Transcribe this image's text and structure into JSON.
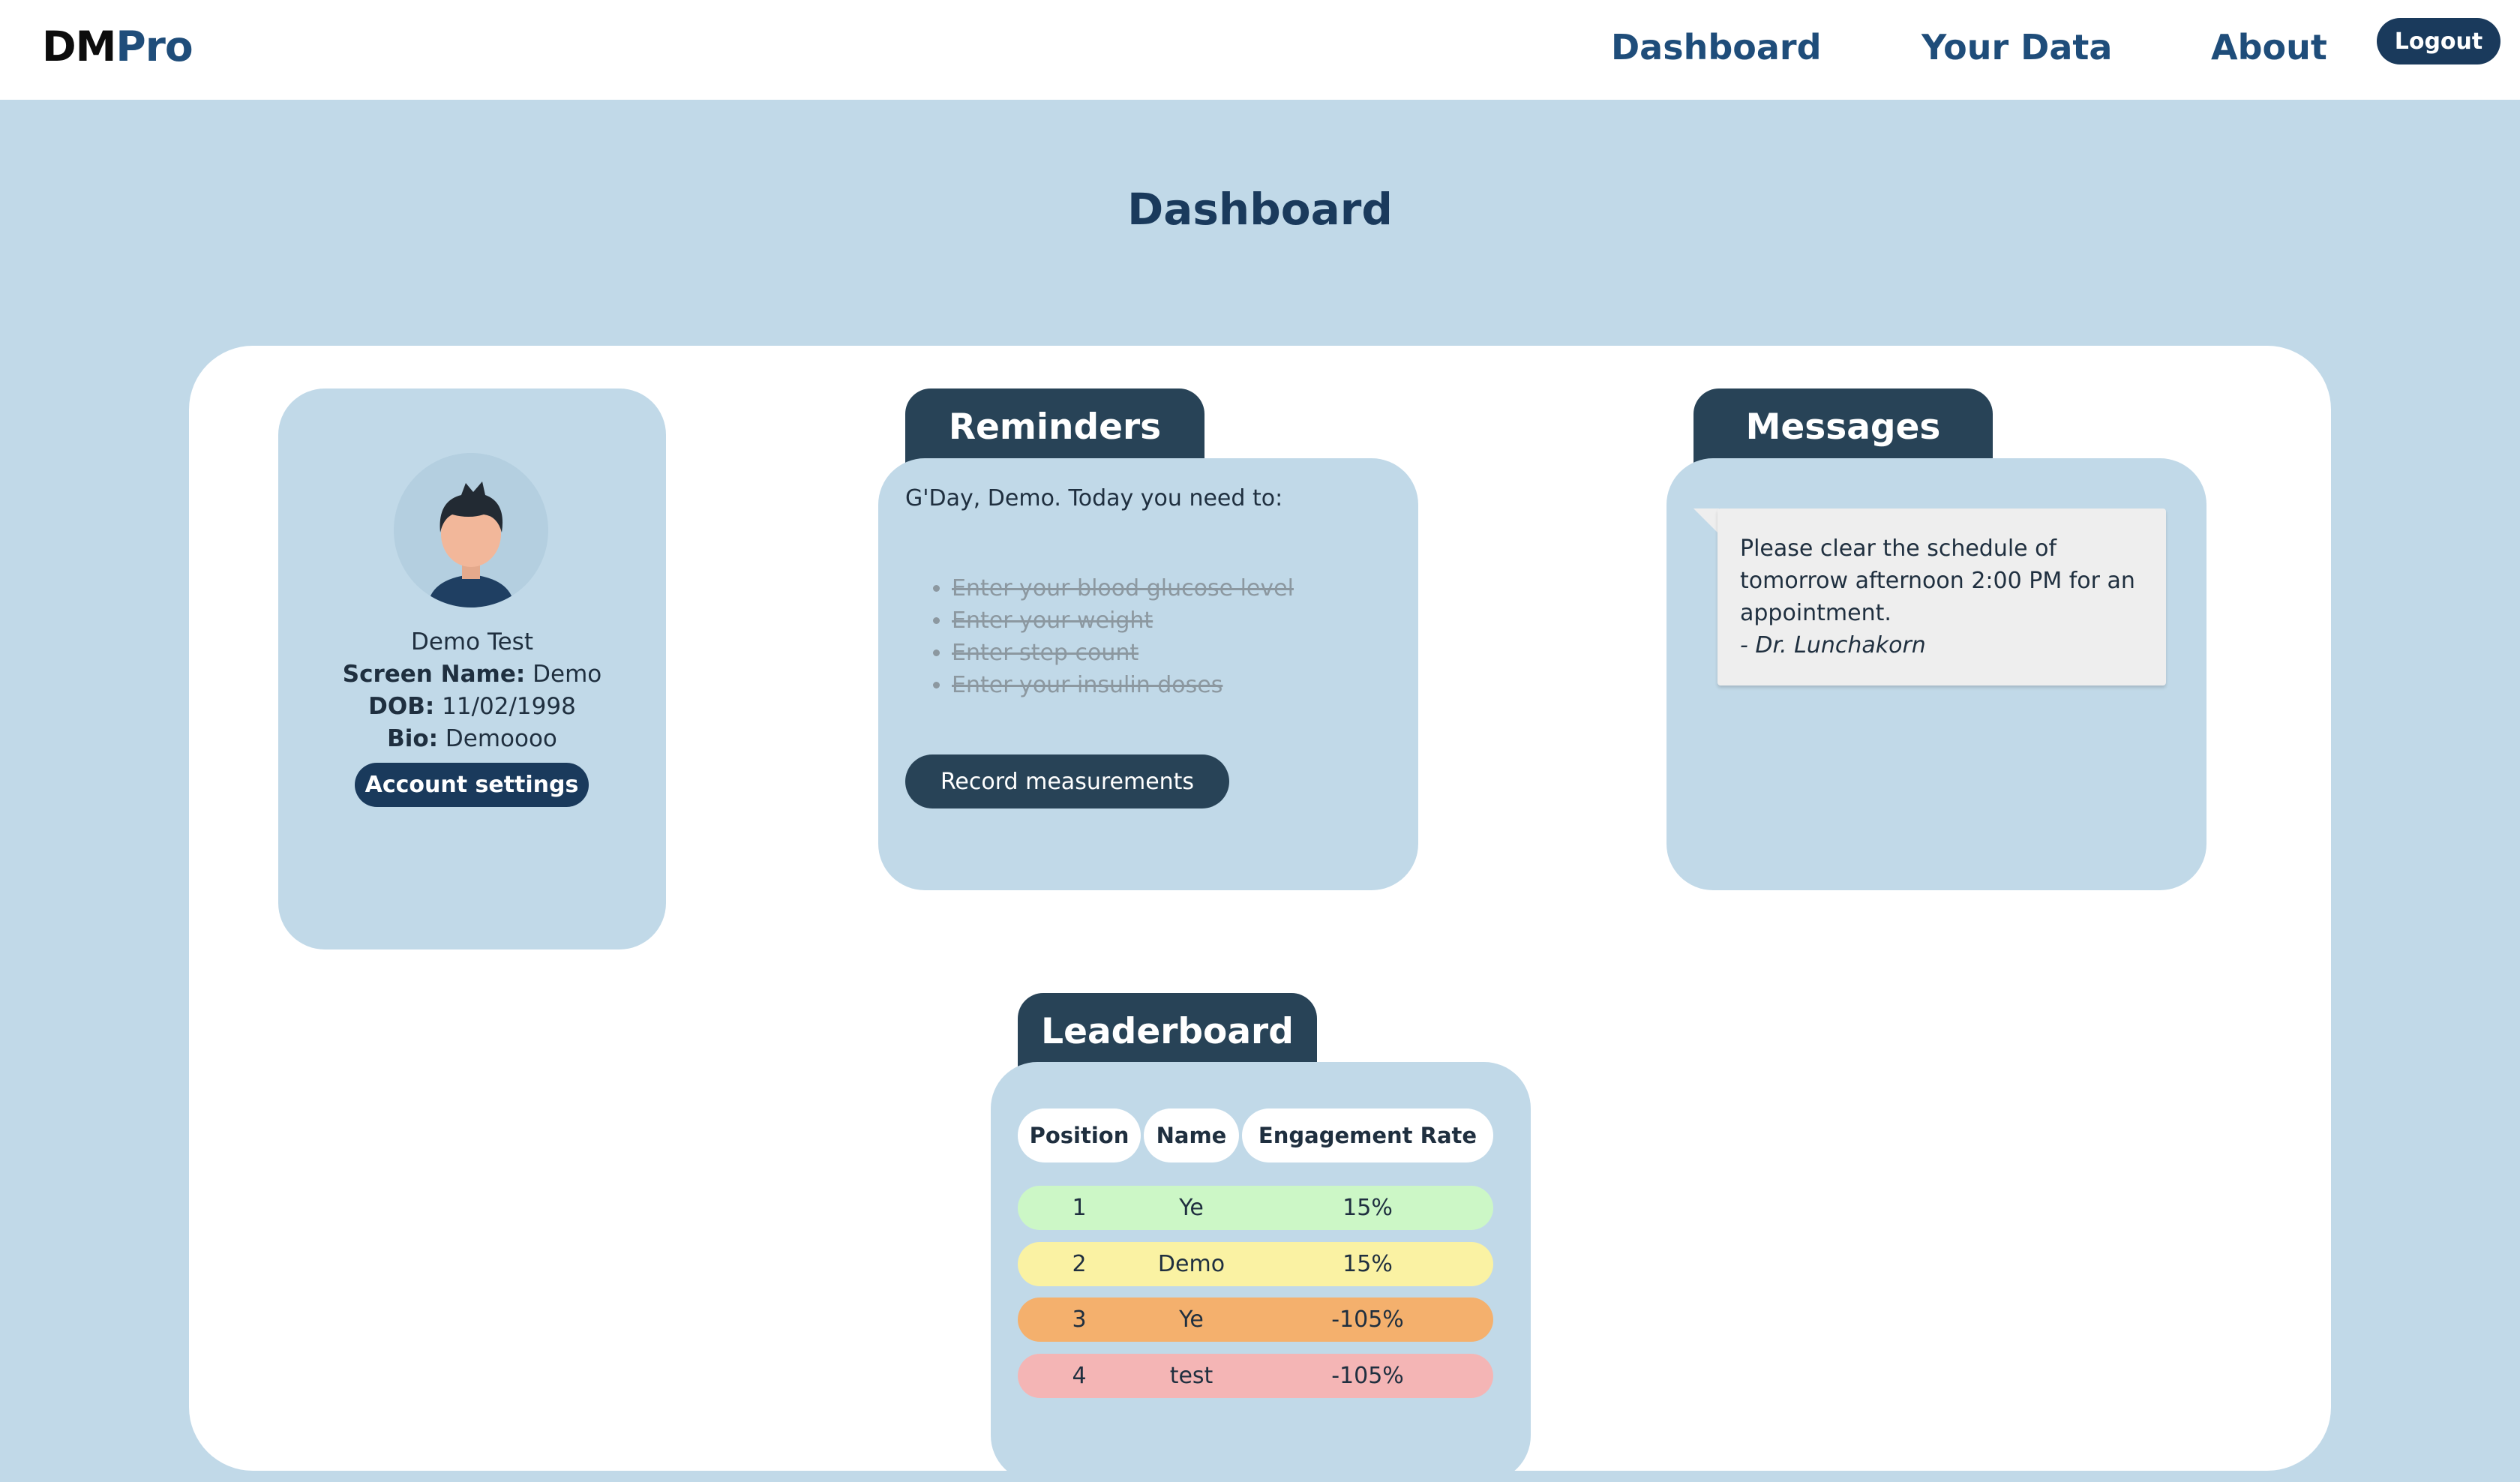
{
  "navbar": {
    "brand_part1": "DM",
    "brand_part2": "Pro",
    "links": [
      "Dashboard",
      "Your Data",
      "About"
    ],
    "logout_label": "Logout"
  },
  "page": {
    "title": "Dashboard"
  },
  "profile": {
    "full_name": "Demo Test",
    "screen_name_label": "Screen Name:",
    "screen_name": "Demo",
    "dob_label": "DOB:",
    "dob": "11/02/1998",
    "bio_label": "Bio:",
    "bio": "Demoooo",
    "account_settings_label": "Account settings"
  },
  "reminders": {
    "title": "Reminders",
    "greeting": "G'Day, Demo. Today you need to:",
    "items": [
      "Enter your blood glucose level",
      "Enter your weight",
      "Enter step count",
      "Enter your insulin doses"
    ],
    "record_button_label": "Record measurements"
  },
  "messages": {
    "title": "Messages",
    "items": [
      {
        "text": "Please clear the schedule of tomorrow afternoon 2:00 PM for an appointment.",
        "signature": "- Dr. Lunchakorn"
      }
    ]
  },
  "leaderboard": {
    "title": "Leaderboard",
    "columns": [
      "Position",
      "Name",
      "Engagement Rate"
    ],
    "rows": [
      {
        "position": "1",
        "name": "Ye",
        "rate": "15%",
        "color": "#ccf7c6"
      },
      {
        "position": "2",
        "name": "Demo",
        "rate": "15%",
        "color": "#faf2a3"
      },
      {
        "position": "3",
        "name": "Ye",
        "rate": "-105%",
        "color": "#f4b06d"
      },
      {
        "position": "4",
        "name": "test",
        "rate": "-105%",
        "color": "#f4b5b5"
      }
    ]
  },
  "colors": {
    "background": "#c1d9e8",
    "navy": "#1a3a5c",
    "tab": "#284357",
    "link": "#1f4d7a"
  }
}
